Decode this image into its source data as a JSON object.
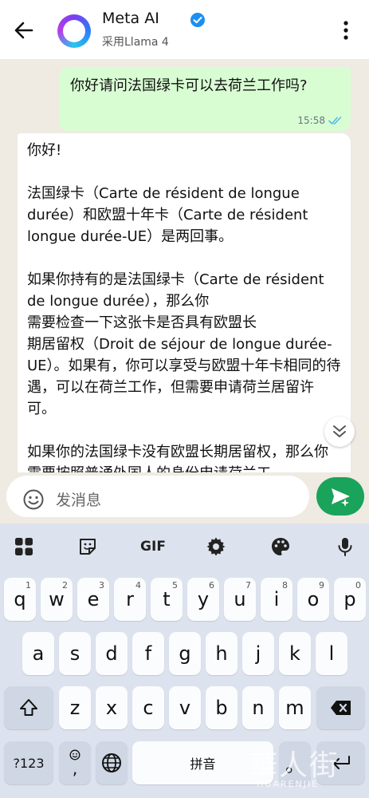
{
  "header": {
    "title": "Meta AI",
    "subtitle": "采用Llama 4"
  },
  "messages": {
    "outgoing": {
      "text": "你好请问法国绿卡可以去荷兰工作吗?",
      "time": "15:58",
      "status": "read"
    },
    "incoming": {
      "paragraphs": [
        "你好!",
        "法国绿卡（Carte de résident de longue durée）和欧盟十年卡（Carte de résident longue durée-UE）是两回事。",
        "如果你持有的是法国绿卡（Carte de résident de longue durée），那么你\n需要检查一下这张卡是否具有欧盟长\n期居留权（Droit de séjour de longue durée-UE）。如果有，你可以享受与欧盟十年卡相同的待遇，可以在荷兰工作，但需要申请荷兰居留许可。",
        "如果你的法国绿卡没有欧盟长期居留权，那么你需要按照普通外国人的身份申请荷兰工"
      ]
    }
  },
  "input": {
    "placeholder": "发消息"
  },
  "keyboard": {
    "toolbar": [
      "apps-grid-icon",
      "sticker-icon",
      "GIF",
      "gear-icon",
      "palette-icon",
      "microphone-icon"
    ],
    "gif_label": "GIF",
    "row1": [
      {
        "key": "q",
        "hint": "1"
      },
      {
        "key": "w",
        "hint": "2"
      },
      {
        "key": "e",
        "hint": "3"
      },
      {
        "key": "r",
        "hint": "4"
      },
      {
        "key": "t",
        "hint": "5"
      },
      {
        "key": "y",
        "hint": "6"
      },
      {
        "key": "u",
        "hint": "7"
      },
      {
        "key": "i",
        "hint": "8"
      },
      {
        "key": "o",
        "hint": "9"
      },
      {
        "key": "p",
        "hint": "0"
      }
    ],
    "row2": [
      "a",
      "s",
      "d",
      "f",
      "g",
      "h",
      "j",
      "k",
      "l"
    ],
    "row3": [
      "z",
      "x",
      "c",
      "v",
      "b",
      "n",
      "m"
    ],
    "symbols_label": "?123",
    "comma_label": ",",
    "space_label": "拼音",
    "period_label": "。"
  },
  "watermark": {
    "text": "華人街",
    "sub": "HUARENJIE"
  },
  "colors": {
    "header_bg": "#ffffff",
    "chat_bg": "#efeae2",
    "outgoing_bubble": "#d9fdd3",
    "incoming_bubble": "#ffffff",
    "send_button": "#1aa35a",
    "read_ticks": "#53bdeb",
    "keyboard_bg": "#dde3ee"
  }
}
